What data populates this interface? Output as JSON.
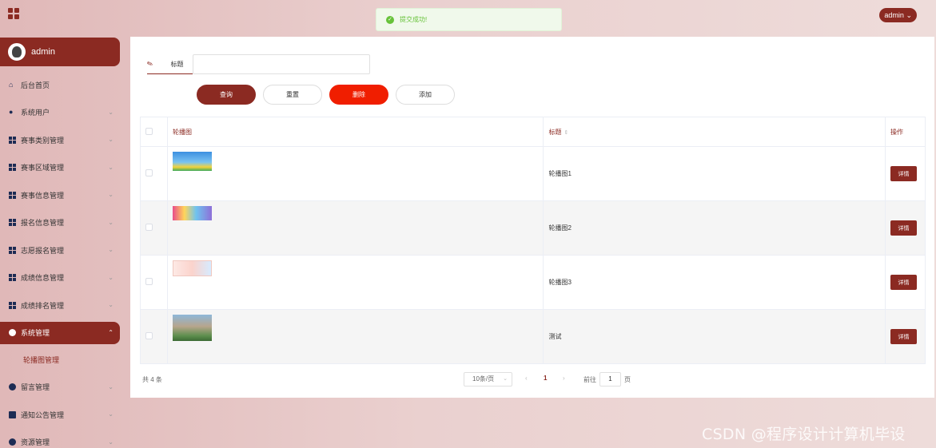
{
  "header": {
    "user_menu": "admin"
  },
  "toast": {
    "message": "提交成功!",
    "color": "#67c23a"
  },
  "sidebar": {
    "username": "admin",
    "items": [
      {
        "label": "后台首页",
        "icon": "home-icon"
      },
      {
        "label": "系统用户",
        "icon": "user-icon"
      },
      {
        "label": "赛事类别管理",
        "icon": "grid-icon"
      },
      {
        "label": "赛事区域管理",
        "icon": "grid-icon"
      },
      {
        "label": "赛事信息管理",
        "icon": "grid-icon"
      },
      {
        "label": "报名信息管理",
        "icon": "grid-icon"
      },
      {
        "label": "志愿报名管理",
        "icon": "grid-icon"
      },
      {
        "label": "成绩信息管理",
        "icon": "grid-icon"
      },
      {
        "label": "成绩排名管理",
        "icon": "grid-icon"
      },
      {
        "label": "系统管理",
        "icon": "settings-icon"
      },
      {
        "label": "轮播图管理",
        "icon": ""
      },
      {
        "label": "留言管理",
        "icon": "settings-icon"
      },
      {
        "label": "通知公告管理",
        "icon": "notice-icon"
      },
      {
        "label": "资源管理",
        "icon": "pie-icon"
      }
    ]
  },
  "search": {
    "title_label": "标题",
    "title_value": ""
  },
  "buttons": {
    "query": "查询",
    "reset": "重置",
    "delete": "删除",
    "add": "添加"
  },
  "table": {
    "headers": {
      "image": "轮播图",
      "title": "标题",
      "action": "操作"
    },
    "rows": [
      {
        "title": "轮播图1",
        "action": "详情"
      },
      {
        "title": "轮播图2",
        "action": "详情"
      },
      {
        "title": "轮播图3",
        "action": "详情"
      },
      {
        "title": "测试",
        "action": "详情"
      }
    ]
  },
  "pagination": {
    "total": "共 4 条",
    "page_size": "10条/页",
    "current_page": "1",
    "goto_label": "前往",
    "goto_value": "1",
    "page_unit": "页"
  },
  "watermark": "CSDN @程序设计计算机毕设",
  "colors": {
    "accent": "#8b2a22",
    "danger": "#f01e00",
    "success": "#67c23a"
  }
}
